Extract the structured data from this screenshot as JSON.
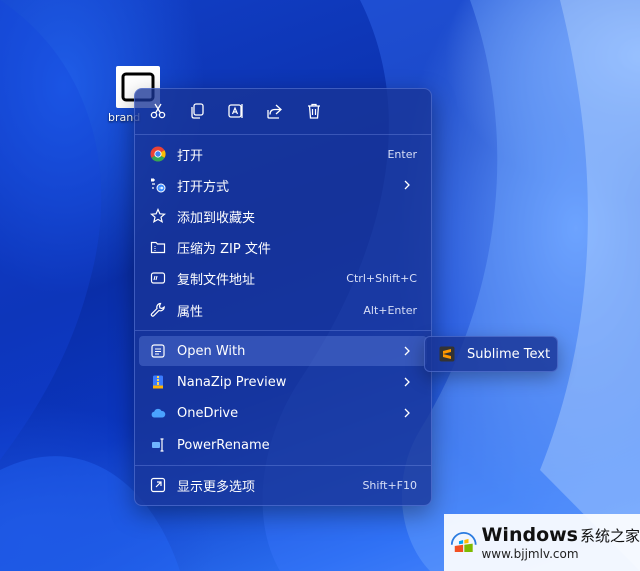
{
  "desktop": {
    "icon_label": "brand"
  },
  "toolbar": {
    "cut": "cut-icon",
    "copy": "copy-icon",
    "rename": "rename-icon",
    "share": "share-icon",
    "delete": "delete-icon"
  },
  "menu": {
    "items": [
      {
        "label": "打开",
        "shortcut": "Enter"
      },
      {
        "label": "打开方式",
        "shortcut": ""
      },
      {
        "label": "添加到收藏夹",
        "shortcut": ""
      },
      {
        "label": "压缩为 ZIP 文件",
        "shortcut": ""
      },
      {
        "label": "复制文件地址",
        "shortcut": "Ctrl+Shift+C"
      },
      {
        "label": "属性",
        "shortcut": "Alt+Enter"
      },
      {
        "label": "Open With",
        "shortcut": ""
      },
      {
        "label": "NanaZip Preview",
        "shortcut": ""
      },
      {
        "label": "OneDrive",
        "shortcut": ""
      },
      {
        "label": "PowerRename",
        "shortcut": ""
      },
      {
        "label": "显示更多选项",
        "shortcut": "Shift+F10"
      }
    ]
  },
  "submenu": {
    "label": "Sublime Text"
  },
  "watermark": {
    "title": "Windows",
    "title_cn": "系统之家",
    "url": "www.bjjmlv.com"
  },
  "colors": {
    "menu_bg": "#18349a",
    "accent": "#2a6ef0",
    "chrome_red": "#ea4335",
    "chrome_green": "#34a853",
    "chrome_yellow": "#fbbc05",
    "chrome_blue": "#4285f4",
    "sublime_orange": "#ff9800"
  }
}
